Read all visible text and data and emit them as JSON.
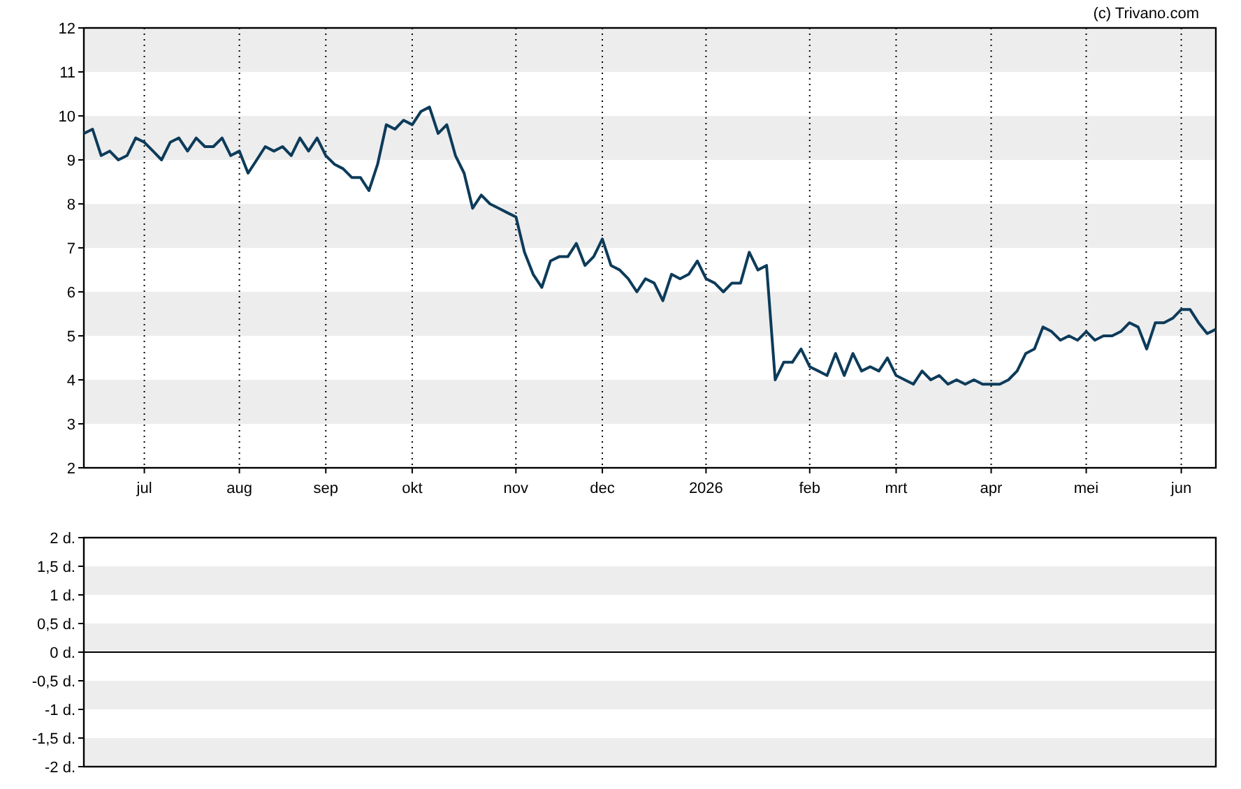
{
  "credit": "(c) Trivano.com",
  "price_chart": {
    "chart_data": {
      "type": "line",
      "ylim": [
        2,
        12
      ],
      "yticks": [
        2,
        3,
        4,
        5,
        6,
        7,
        8,
        9,
        10,
        11,
        12
      ],
      "categories": [
        null,
        null,
        null,
        null,
        null,
        null,
        null,
        "jul",
        null,
        null,
        null,
        null,
        null,
        null,
        null,
        null,
        null,
        null,
        "aug",
        null,
        null,
        null,
        null,
        null,
        null,
        null,
        null,
        null,
        "sep",
        null,
        null,
        null,
        null,
        null,
        null,
        null,
        null,
        null,
        "okt",
        null,
        null,
        null,
        null,
        null,
        null,
        null,
        null,
        null,
        null,
        null,
        "nov",
        null,
        null,
        null,
        null,
        null,
        null,
        null,
        null,
        null,
        "dec",
        null,
        null,
        null,
        null,
        null,
        null,
        null,
        null,
        null,
        null,
        null,
        "2026",
        null,
        null,
        null,
        null,
        null,
        null,
        null,
        null,
        null,
        null,
        null,
        "feb",
        null,
        null,
        null,
        null,
        null,
        null,
        null,
        null,
        null,
        "mrt",
        null,
        null,
        null,
        null,
        null,
        null,
        null,
        null,
        null,
        null,
        "apr",
        null,
        null,
        null,
        null,
        null,
        null,
        null,
        null,
        null,
        null,
        "mei",
        null,
        null,
        null,
        null,
        null,
        null,
        null,
        null,
        null,
        null,
        "jun",
        null,
        null,
        null,
        null
      ],
      "series": [
        {
          "color": "#0d3b5a",
          "values": [
            9.6,
            9.7,
            9.1,
            9.2,
            9.0,
            9.1,
            9.5,
            9.4,
            9.2,
            9.0,
            9.4,
            9.5,
            9.2,
            9.5,
            9.3,
            9.3,
            9.5,
            9.1,
            9.2,
            8.7,
            9.0,
            9.3,
            9.2,
            9.3,
            9.1,
            9.5,
            9.2,
            9.5,
            9.1,
            8.9,
            8.8,
            8.6,
            8.6,
            8.3,
            8.9,
            9.8,
            9.7,
            9.9,
            9.8,
            10.1,
            10.2,
            9.6,
            9.8,
            9.1,
            8.7,
            7.9,
            8.2,
            8.0,
            7.9,
            7.8,
            7.7,
            6.9,
            6.4,
            6.1,
            6.7,
            6.8,
            6.8,
            7.1,
            6.6,
            6.8,
            7.2,
            6.6,
            6.5,
            6.3,
            6.0,
            6.3,
            6.2,
            5.8,
            6.4,
            6.3,
            6.4,
            6.7,
            6.3,
            6.2,
            6.0,
            6.2,
            6.2,
            6.9,
            6.5,
            6.6,
            4.0,
            4.4,
            4.4,
            4.7,
            4.3,
            4.2,
            4.1,
            4.6,
            4.1,
            4.6,
            4.2,
            4.3,
            4.2,
            4.5,
            4.1,
            4.0,
            3.9,
            4.2,
            4.0,
            4.1,
            3.9,
            4.0,
            3.9,
            4.0,
            3.9,
            3.9,
            3.9,
            4.0,
            4.2,
            4.6,
            4.7,
            5.2,
            5.1,
            4.9,
            5.0,
            4.9,
            5.1,
            4.9,
            5.0,
            5.0,
            5.1,
            5.3,
            5.2,
            4.7,
            5.3,
            5.3,
            5.4,
            5.6,
            5.6,
            5.3,
            5.05,
            5.15
          ]
        }
      ]
    }
  },
  "dividend_chart": {
    "chart_data": {
      "type": "bar",
      "ylim": [
        -2,
        2
      ],
      "categories": [
        null
      ],
      "values": [
        null
      ],
      "yticks": [
        {
          "value": 2,
          "label": "2 d."
        },
        {
          "value": 1.5,
          "label": "1,5 d."
        },
        {
          "value": 1,
          "label": "1 d."
        },
        {
          "value": 0.5,
          "label": "0,5 d."
        },
        {
          "value": 0,
          "label": "0 d."
        },
        {
          "value": -0.5,
          "label": "-0,5 d."
        },
        {
          "value": -1,
          "label": "-1 d."
        },
        {
          "value": -1.5,
          "label": "-1,5 d."
        },
        {
          "value": -2,
          "label": "-2 d."
        }
      ]
    }
  }
}
